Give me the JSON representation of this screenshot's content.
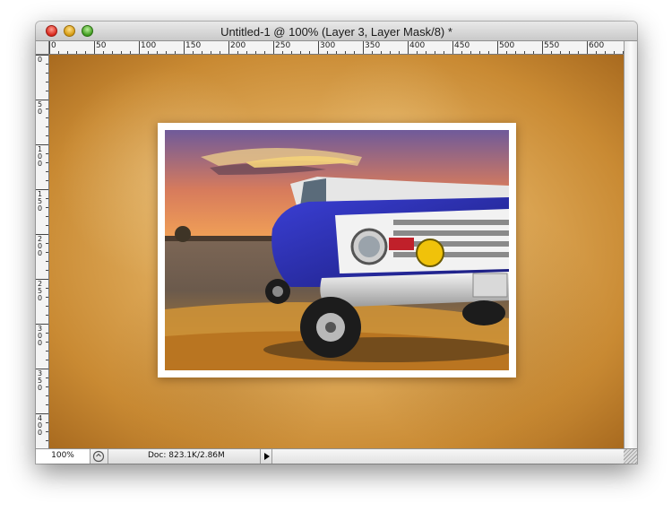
{
  "window": {
    "title": "Untitled-1 @ 100% (Layer 3, Layer Mask/8) *"
  },
  "rulers": {
    "horizontal_labels": [
      "0",
      "50",
      "100",
      "150",
      "200",
      "250",
      "300",
      "350",
      "400",
      "450",
      "500",
      "550",
      "600"
    ],
    "vertical_labels": [
      "0",
      "50",
      "100",
      "150",
      "200",
      "250",
      "300",
      "350",
      "400"
    ]
  },
  "status": {
    "zoom": "100%",
    "doc_info": "Doc: 823.1K/2.86M"
  },
  "colors": {
    "background_light": "#f1cf87",
    "background_dark": "#a86a1f",
    "truck_blue": "#2a2fb0",
    "photo_border": "#ffffff"
  },
  "icons": {
    "close": "close-icon",
    "minimize": "minimize-icon",
    "zoom": "zoom-icon",
    "status_menu": "triangle-right-icon",
    "status_info": "info-icon"
  }
}
